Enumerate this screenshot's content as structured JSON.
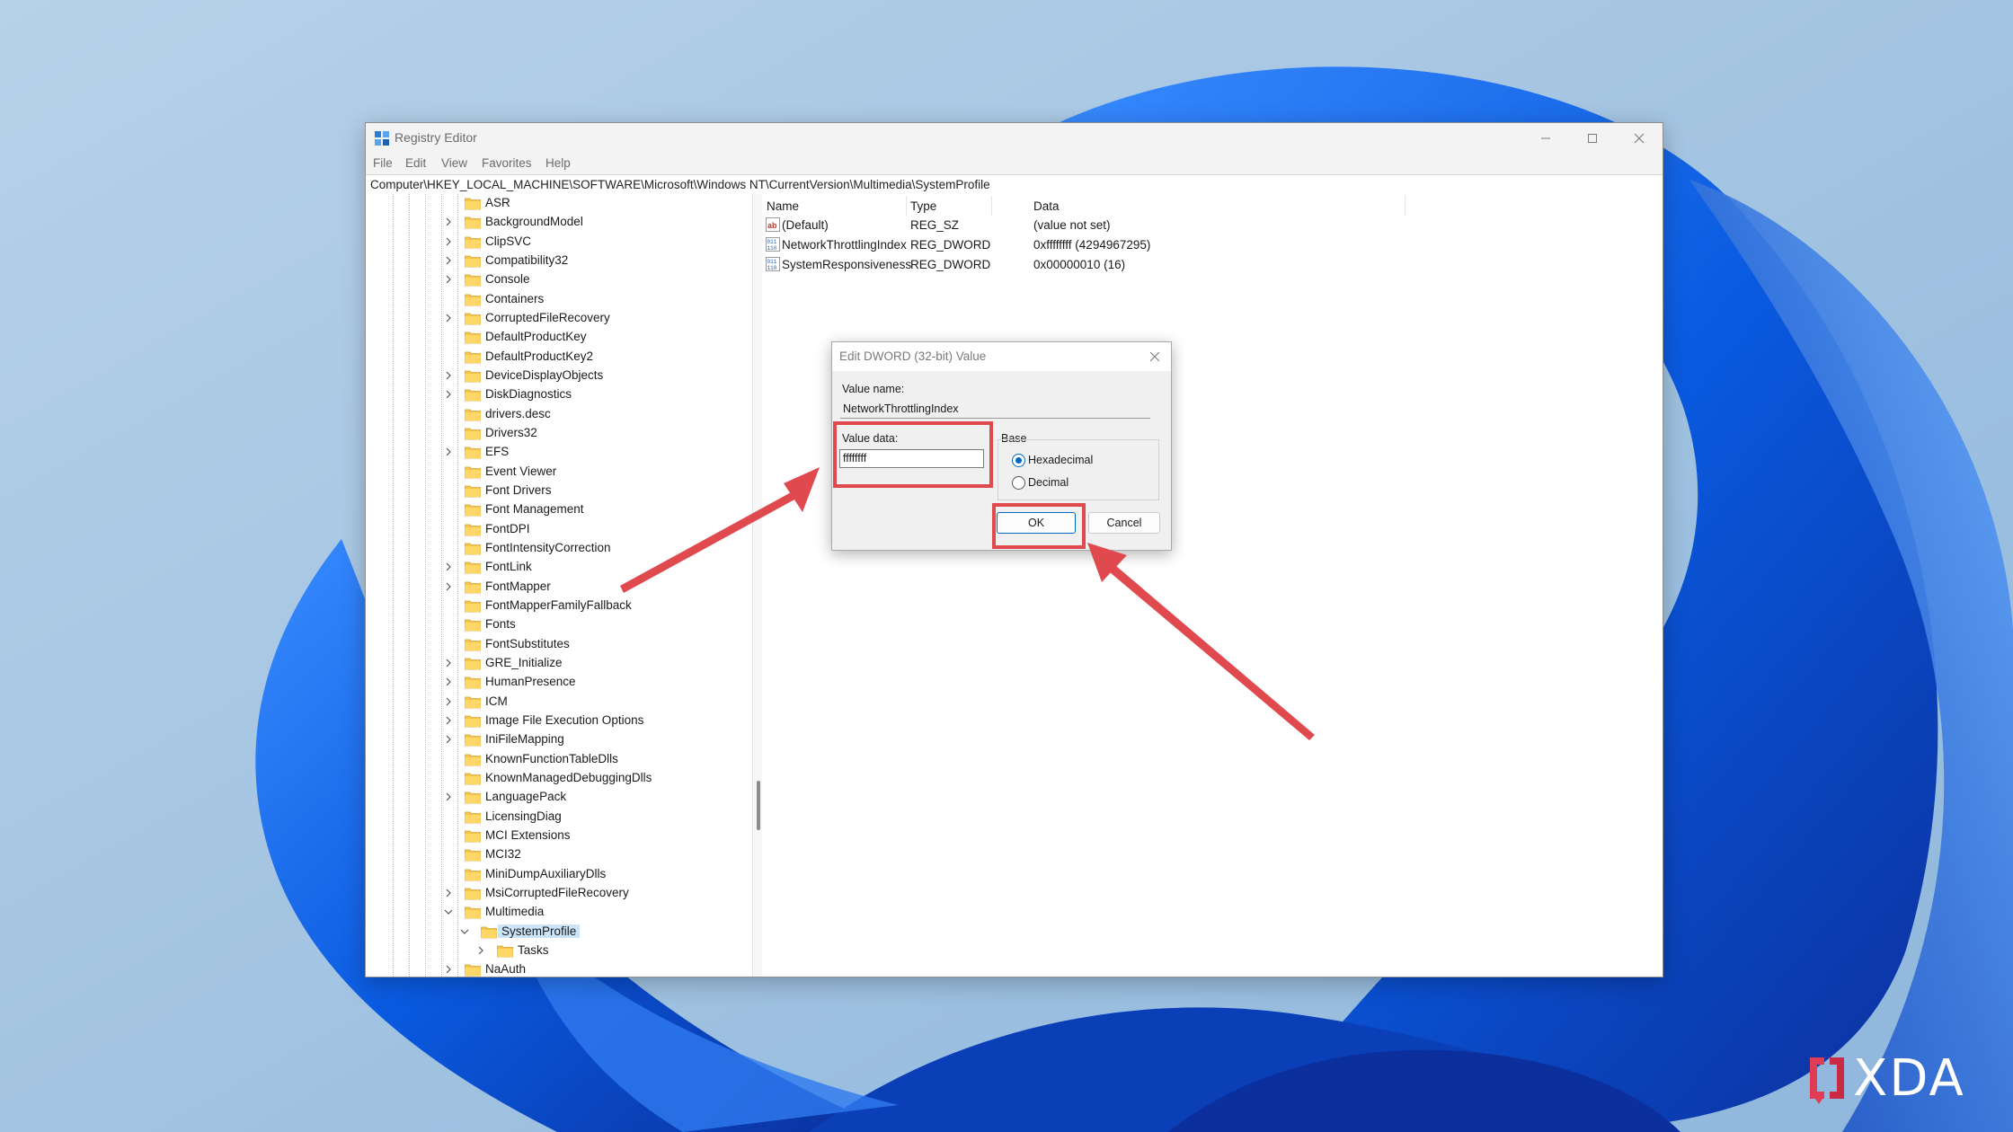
{
  "window": {
    "title": "Registry Editor",
    "menu": [
      "File",
      "Edit",
      "View",
      "Favorites",
      "Help"
    ],
    "address": "Computer\\HKEY_LOCAL_MACHINE\\SOFTWARE\\Microsoft\\Windows NT\\CurrentVersion\\Multimedia\\SystemProfile"
  },
  "tree": {
    "items": [
      {
        "label": "ASR",
        "expander": false
      },
      {
        "label": "BackgroundModel",
        "expander": true
      },
      {
        "label": "ClipSVC",
        "expander": true
      },
      {
        "label": "Compatibility32",
        "expander": true
      },
      {
        "label": "Console",
        "expander": true
      },
      {
        "label": "Containers",
        "expander": false
      },
      {
        "label": "CorruptedFileRecovery",
        "expander": true
      },
      {
        "label": "DefaultProductKey",
        "expander": false
      },
      {
        "label": "DefaultProductKey2",
        "expander": false
      },
      {
        "label": "DeviceDisplayObjects",
        "expander": true
      },
      {
        "label": "DiskDiagnostics",
        "expander": true
      },
      {
        "label": "drivers.desc",
        "expander": false
      },
      {
        "label": "Drivers32",
        "expander": false
      },
      {
        "label": "EFS",
        "expander": true
      },
      {
        "label": "Event Viewer",
        "expander": false
      },
      {
        "label": "Font Drivers",
        "expander": false
      },
      {
        "label": "Font Management",
        "expander": false
      },
      {
        "label": "FontDPI",
        "expander": false
      },
      {
        "label": "FontIntensityCorrection",
        "expander": false
      },
      {
        "label": "FontLink",
        "expander": true
      },
      {
        "label": "FontMapper",
        "expander": true
      },
      {
        "label": "FontMapperFamilyFallback",
        "expander": false
      },
      {
        "label": "Fonts",
        "expander": false
      },
      {
        "label": "FontSubstitutes",
        "expander": false
      },
      {
        "label": "GRE_Initialize",
        "expander": true
      },
      {
        "label": "HumanPresence",
        "expander": true
      },
      {
        "label": "ICM",
        "expander": true
      },
      {
        "label": "Image File Execution Options",
        "expander": true
      },
      {
        "label": "IniFileMapping",
        "expander": true
      },
      {
        "label": "KnownFunctionTableDlls",
        "expander": false
      },
      {
        "label": "KnownManagedDebuggingDlls",
        "expander": false
      },
      {
        "label": "LanguagePack",
        "expander": true
      },
      {
        "label": "LicensingDiag",
        "expander": false
      },
      {
        "label": "MCI Extensions",
        "expander": false
      },
      {
        "label": "MCI32",
        "expander": false
      },
      {
        "label": "MiniDumpAuxiliaryDlls",
        "expander": false
      },
      {
        "label": "MsiCorruptedFileRecovery",
        "expander": true
      },
      {
        "label": "Multimedia",
        "expander": "open"
      },
      {
        "label": "SystemProfile",
        "expander": "open",
        "level": 1,
        "selected": true
      },
      {
        "label": "Tasks",
        "expander": true,
        "level": 2
      },
      {
        "label": "NaAuth",
        "expander": true
      }
    ]
  },
  "values": {
    "headers": [
      "Name",
      "Type",
      "Data"
    ],
    "rows": [
      {
        "name": "(Default)",
        "type": "REG_SZ",
        "data": "(value not set)",
        "icon": "string-value-icon"
      },
      {
        "name": "NetworkThrottlingIndex",
        "type": "REG_DWORD",
        "data": "0xffffffff (4294967295)",
        "icon": "binary-value-icon"
      },
      {
        "name": "SystemResponsiveness",
        "type": "REG_DWORD",
        "data": "0x00000010 (16)",
        "icon": "binary-value-icon"
      }
    ]
  },
  "dialog": {
    "title": "Edit DWORD (32-bit) Value",
    "value_name_label": "Value name:",
    "value_name": "NetworkThrottlingIndex",
    "value_data_label": "Value data:",
    "value_data": "ffffffff",
    "base_label": "Base",
    "hex_label": "Hexadecimal",
    "dec_label": "Decimal",
    "base_selected": "Hexadecimal",
    "ok_label": "OK",
    "cancel_label": "Cancel"
  },
  "colors": {
    "annotation": "#e04a4f",
    "selection": "#cce4f7",
    "accent": "#0067c0"
  },
  "watermark": "XDA"
}
